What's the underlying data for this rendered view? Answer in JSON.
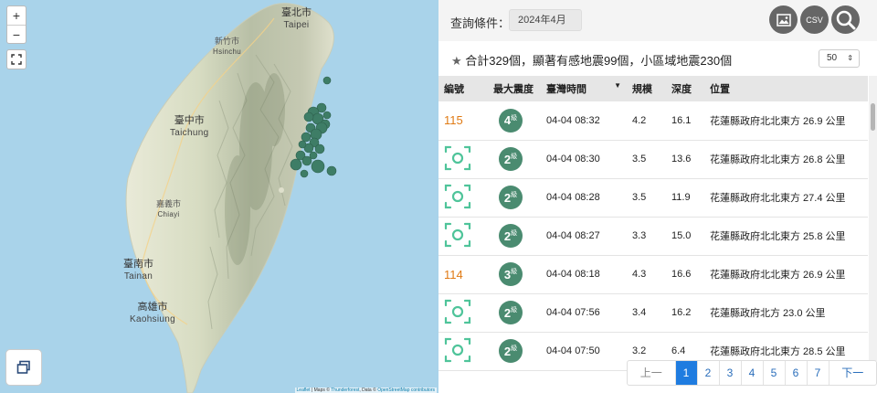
{
  "map": {
    "zoom_in": "+",
    "zoom_out": "−",
    "cities": [
      {
        "zh": "臺北市",
        "en": "Taipei"
      },
      {
        "zh": "新竹市",
        "en": "Hsinchu"
      },
      {
        "zh": "臺中市",
        "en": "Taichung"
      },
      {
        "zh": "嘉義市",
        "en": "Chiayi"
      },
      {
        "zh": "臺南市",
        "en": "Tainan"
      },
      {
        "zh": "高雄市",
        "en": "Kaohsiung"
      }
    ],
    "attribution": {
      "leaflet": "Leaflet",
      "sep1": " | Maps © ",
      "thunderforest": "Thunderforest",
      "sep2": ", Data © ",
      "osm": "OpenStreetMap contributors"
    },
    "marker_color": "#3e7d66"
  },
  "query": {
    "label": "查詢條件：",
    "value": "2024年4月",
    "csv_label": "CSV"
  },
  "summary": {
    "star": "★",
    "text": "合計329個，顯著有感地震99個，小區域地震230個"
  },
  "per_page": "50",
  "table": {
    "headers": [
      "編號",
      "最大震度",
      "臺灣時間",
      "規模",
      "深度",
      "位置"
    ],
    "sort_indicator": "▼",
    "rows": [
      {
        "id": "115",
        "intensity": "4",
        "unit": "級",
        "time": "04-04 08:32",
        "mag": "4.2",
        "depth": "16.1",
        "loc": "花蓮縣政府北北東方 26.9 公里"
      },
      {
        "id": "",
        "intensity": "2",
        "unit": "級",
        "time": "04-04 08:30",
        "mag": "3.5",
        "depth": "13.6",
        "loc": "花蓮縣政府北北東方 26.8 公里"
      },
      {
        "id": "",
        "intensity": "2",
        "unit": "級",
        "time": "04-04 08:28",
        "mag": "3.5",
        "depth": "11.9",
        "loc": "花蓮縣政府北北東方 27.4 公里"
      },
      {
        "id": "",
        "intensity": "2",
        "unit": "級",
        "time": "04-04 08:27",
        "mag": "3.3",
        "depth": "15.0",
        "loc": "花蓮縣政府北北東方 25.8 公里"
      },
      {
        "id": "114",
        "intensity": "3",
        "unit": "級",
        "time": "04-04 08:18",
        "mag": "4.3",
        "depth": "16.6",
        "loc": "花蓮縣政府北北東方 26.9 公里"
      },
      {
        "id": "",
        "intensity": "2",
        "unit": "級",
        "time": "04-04 07:56",
        "mag": "3.4",
        "depth": "16.2",
        "loc": "花蓮縣政府北方 23.0 公里"
      },
      {
        "id": "",
        "intensity": "2",
        "unit": "級",
        "time": "04-04 07:50",
        "mag": "3.2",
        "depth": "6.4",
        "loc": "花蓮縣政府北北東方 28.5 公里"
      }
    ]
  },
  "pager": {
    "prev": "上一頁",
    "pages": [
      "1",
      "2",
      "3",
      "4",
      "5",
      "6",
      "7"
    ],
    "active": "1",
    "next": "下一頁"
  },
  "colors": {
    "badge": "#4a8b70",
    "number": "#e07a14",
    "small_quake_icon": "#4fc49a",
    "active_page": "#1f7ce0"
  }
}
